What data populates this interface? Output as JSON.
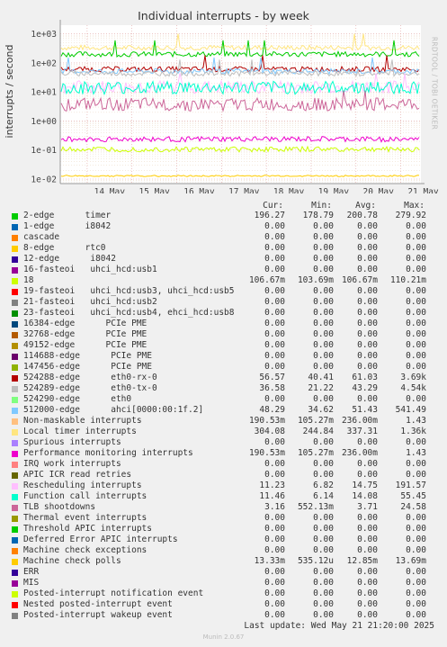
{
  "title": "Individual interrupts - by week",
  "ylabel": "interrupts / second",
  "side_label": "RRDTOOL / TOBI OETIKER",
  "table_headers": [
    "Cur:",
    "Min:",
    "Avg:",
    "Max:"
  ],
  "last_update": "Last update: Wed May 21 21:20:00 2025",
  "footer": "Munin 2.0.67",
  "legend": [
    {
      "label": "2-edge      timer",
      "color": "#00cc00",
      "cur": "196.27",
      "min": "178.79",
      "avg": "200.78",
      "max": "279.92"
    },
    {
      "label": "1-edge      i8042",
      "color": "#0066b3",
      "cur": "0.00",
      "min": "0.00",
      "avg": "0.00",
      "max": "0.00"
    },
    {
      "label": "cascade",
      "color": "#ff8000",
      "cur": "0.00",
      "min": "0.00",
      "avg": "0.00",
      "max": "0.00"
    },
    {
      "label": "8-edge      rtc0",
      "color": "#ffcc00",
      "cur": "0.00",
      "min": "0.00",
      "avg": "0.00",
      "max": "0.00"
    },
    {
      "label": "12-edge      i8042",
      "color": "#330099",
      "cur": "0.00",
      "min": "0.00",
      "avg": "0.00",
      "max": "0.00"
    },
    {
      "label": "16-fasteoi   uhci_hcd:usb1",
      "color": "#990099",
      "cur": "0.00",
      "min": "0.00",
      "avg": "0.00",
      "max": "0.00"
    },
    {
      "label": "18",
      "color": "#ccff00",
      "cur": "106.67m",
      "min": "103.69m",
      "avg": "106.67m",
      "max": "110.21m"
    },
    {
      "label": "19-fasteoi   uhci_hcd:usb3, uhci_hcd:usb5",
      "color": "#ff0000",
      "cur": "0.00",
      "min": "0.00",
      "avg": "0.00",
      "max": "0.00"
    },
    {
      "label": "21-fasteoi   uhci_hcd:usb2",
      "color": "#808080",
      "cur": "0.00",
      "min": "0.00",
      "avg": "0.00",
      "max": "0.00"
    },
    {
      "label": "23-fasteoi   uhci_hcd:usb4, ehci_hcd:usb8",
      "color": "#008f00",
      "cur": "0.00",
      "min": "0.00",
      "avg": "0.00",
      "max": "0.00"
    },
    {
      "label": "16384-edge      PCIe PME",
      "color": "#00487d",
      "cur": "0.00",
      "min": "0.00",
      "avg": "0.00",
      "max": "0.00"
    },
    {
      "label": "32768-edge      PCIe PME",
      "color": "#b35a00",
      "cur": "0.00",
      "min": "0.00",
      "avg": "0.00",
      "max": "0.00"
    },
    {
      "label": "49152-edge      PCIe PME",
      "color": "#b38f00",
      "cur": "0.00",
      "min": "0.00",
      "avg": "0.00",
      "max": "0.00"
    },
    {
      "label": "114688-edge      PCIe PME",
      "color": "#6b006b",
      "cur": "0.00",
      "min": "0.00",
      "avg": "0.00",
      "max": "0.00"
    },
    {
      "label": "147456-edge      PCIe PME",
      "color": "#8fb300",
      "cur": "0.00",
      "min": "0.00",
      "avg": "0.00",
      "max": "0.00"
    },
    {
      "label": "524288-edge      eth0-rx-0",
      "color": "#b30000",
      "cur": "56.57",
      "min": "40.41",
      "avg": "61.03",
      "max": "3.69k"
    },
    {
      "label": "524289-edge      eth0-tx-0",
      "color": "#bebebe",
      "cur": "36.58",
      "min": "21.22",
      "avg": "43.29",
      "max": "4.54k"
    },
    {
      "label": "524290-edge      eth0",
      "color": "#80ff80",
      "cur": "0.00",
      "min": "0.00",
      "avg": "0.00",
      "max": "0.00"
    },
    {
      "label": "512000-edge      ahci[0000:00:1f.2]",
      "color": "#80c9ff",
      "cur": "48.29",
      "min": "34.62",
      "avg": "51.43",
      "max": "541.49"
    },
    {
      "label": "Non-maskable interrupts",
      "color": "#ffc080",
      "cur": "190.53m",
      "min": "105.27m",
      "avg": "236.00m",
      "max": "1.43"
    },
    {
      "label": "Local timer interrupts",
      "color": "#ffe680",
      "cur": "304.08",
      "min": "244.84",
      "avg": "337.31",
      "max": "1.36k"
    },
    {
      "label": "Spurious interrupts",
      "color": "#aa80ff",
      "cur": "0.00",
      "min": "0.00",
      "avg": "0.00",
      "max": "0.00"
    },
    {
      "label": "Performance monitoring interrupts",
      "color": "#ee00cc",
      "cur": "190.53m",
      "min": "105.27m",
      "avg": "236.00m",
      "max": "1.43"
    },
    {
      "label": "IRQ work interrupts",
      "color": "#ff8080",
      "cur": "0.00",
      "min": "0.00",
      "avg": "0.00",
      "max": "0.00"
    },
    {
      "label": "APIC ICR read retries",
      "color": "#666600",
      "cur": "0.00",
      "min": "0.00",
      "avg": "0.00",
      "max": "0.00"
    },
    {
      "label": "Rescheduling interrupts",
      "color": "#ffbfff",
      "cur": "11.23",
      "min": "6.82",
      "avg": "14.75",
      "max": "191.57"
    },
    {
      "label": "Function call interrupts",
      "color": "#00ffcc",
      "cur": "11.46",
      "min": "6.14",
      "avg": "14.08",
      "max": "55.45"
    },
    {
      "label": "TLB shootdowns",
      "color": "#cc6699",
      "cur": "3.16",
      "min": "552.13m",
      "avg": "3.71",
      "max": "24.58"
    },
    {
      "label": "Thermal event interrupts",
      "color": "#999900",
      "cur": "0.00",
      "min": "0.00",
      "avg": "0.00",
      "max": "0.00"
    },
    {
      "label": "Threshold APIC interrupts",
      "color": "#00cc00",
      "cur": "0.00",
      "min": "0.00",
      "avg": "0.00",
      "max": "0.00"
    },
    {
      "label": "Deferred Error APIC interrupts",
      "color": "#0066b3",
      "cur": "0.00",
      "min": "0.00",
      "avg": "0.00",
      "max": "0.00"
    },
    {
      "label": "Machine check exceptions",
      "color": "#ff8000",
      "cur": "0.00",
      "min": "0.00",
      "avg": "0.00",
      "max": "0.00"
    },
    {
      "label": "Machine check polls",
      "color": "#ffcc00",
      "cur": "13.33m",
      "min": "535.12u",
      "avg": "12.85m",
      "max": "13.69m"
    },
    {
      "label": "ERR",
      "color": "#330099",
      "cur": "0.00",
      "min": "0.00",
      "avg": "0.00",
      "max": "0.00"
    },
    {
      "label": "MIS",
      "color": "#990099",
      "cur": "0.00",
      "min": "0.00",
      "avg": "0.00",
      "max": "0.00"
    },
    {
      "label": "Posted-interrupt notification event",
      "color": "#ccff00",
      "cur": "0.00",
      "min": "0.00",
      "avg": "0.00",
      "max": "0.00"
    },
    {
      "label": "Nested posted-interrupt event",
      "color": "#ff0000",
      "cur": "0.00",
      "min": "0.00",
      "avg": "0.00",
      "max": "0.00"
    },
    {
      "label": "Posted-interrupt wakeup event",
      "color": "#808080",
      "cur": "0.00",
      "min": "0.00",
      "avg": "0.00",
      "max": "0.00"
    }
  ],
  "chart_data": {
    "type": "line",
    "title": "Individual interrupts - by week",
    "ylabel": "interrupts / second",
    "yscale": "log",
    "ylim": [
      0.007,
      2000
    ],
    "yticks": [
      0.01,
      0.1,
      1,
      10,
      100,
      1000
    ],
    "ytick_labels": [
      "1e-02",
      "1e-01",
      "1e+00",
      "1e+01",
      "1e+02",
      "1e+03"
    ],
    "x_ticks": [
      "14 May",
      "15 May",
      "16 May",
      "17 May",
      "18 May",
      "19 May",
      "20 May",
      "21 May"
    ],
    "grid": true,
    "series": [
      {
        "name": "Local timer interrupts",
        "color": "#ffe680",
        "level": 337.31
      },
      {
        "name": "2-edge      timer",
        "color": "#00cc00",
        "level": 200.78
      },
      {
        "name": "524288-edge      eth0-rx-0",
        "color": "#b30000",
        "level": 61.03
      },
      {
        "name": "512000-edge      ahci[0000:00:1f.2]",
        "color": "#80c9ff",
        "level": 51.43
      },
      {
        "name": "524289-edge      eth0-tx-0",
        "color": "#bebebe",
        "level": 43.29
      },
      {
        "name": "Rescheduling interrupts",
        "color": "#ffbfff",
        "level": 14.75
      },
      {
        "name": "Function call interrupts",
        "color": "#00ffcc",
        "level": 14.08
      },
      {
        "name": "TLB shootdowns",
        "color": "#cc6699",
        "level": 3.71
      },
      {
        "name": "Performance monitoring interrupts",
        "color": "#ee00cc",
        "level": 0.236
      },
      {
        "name": "18",
        "color": "#ccff00",
        "level": 0.10667
      },
      {
        "name": "Machine check polls",
        "color": "#ffcc00",
        "level": 0.01285
      }
    ]
  }
}
